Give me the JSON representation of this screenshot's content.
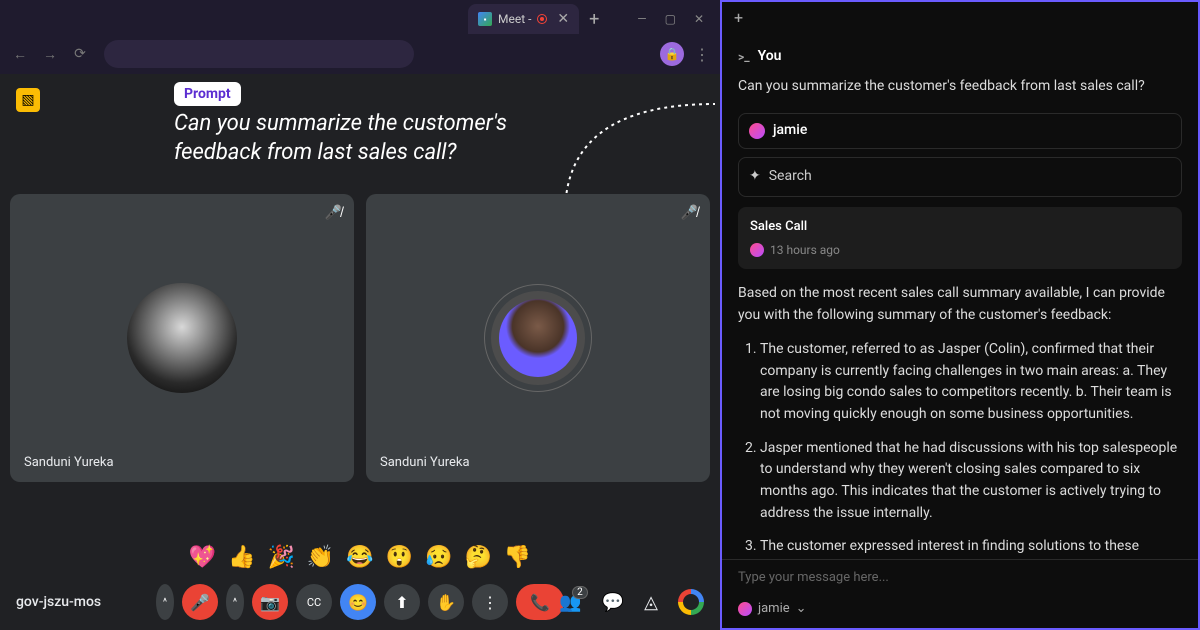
{
  "browser": {
    "tab_title": "Meet - ",
    "new_tab": "+",
    "win_min": "—",
    "win_max": "▢",
    "win_close": "✕"
  },
  "meet": {
    "prompt_label": "Prompt",
    "prompt_text": "Can you summarize the customer's feedback from last sales call?",
    "tiles": [
      {
        "name": "Sanduni Yureka"
      },
      {
        "name": "Sanduni Yureka"
      }
    ],
    "reactions": [
      "💖",
      "👍",
      "🎉",
      "👏",
      "😂",
      "😲",
      "😥",
      "🤔",
      "👎"
    ],
    "meeting_id": "gov-jszu-mos",
    "people_count": "2"
  },
  "panel": {
    "you_label": "You",
    "question": "Can you summarize the customer's feedback from last sales call?",
    "ai_name": "jamie",
    "search_label": "Search",
    "card_title": "Sales Call",
    "card_time": "13 hours ago",
    "intro": "Based on the most recent sales call summary available, I can provide you with the following summary of the customer's feedback:",
    "points": [
      "The customer, referred to as Jasper (Colin), confirmed that their company is currently facing challenges in two main areas:\na. They are losing big condo sales to competitors recently. b. Their team is not moving quickly enough on some business opportunities.",
      "Jasper mentioned that he had discussions with his top salespeople to understand why they weren't closing sales compared to six months ago. This indicates that the customer is actively trying to address the issue internally.",
      "The customer expressed interest in finding solutions to these challenges, as evidenced by their willingness to schedule a face-to-face meeting to discuss"
    ],
    "input_placeholder": "Type your message here...",
    "footer_name": "jamie"
  }
}
